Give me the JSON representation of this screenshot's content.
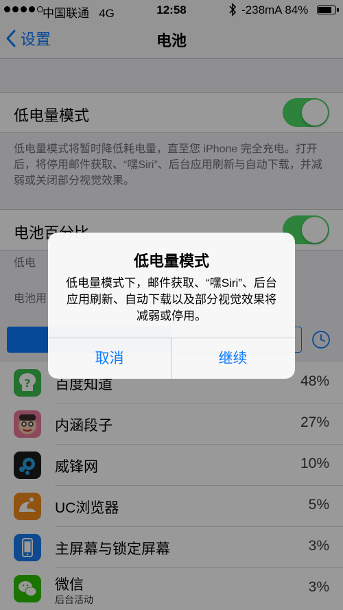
{
  "status_bar": {
    "carrier": "中国联通",
    "network": "4G",
    "time": "12:58",
    "current": "-238mA",
    "battery_percent": "84%",
    "battery_level": 0.84
  },
  "nav": {
    "back_label": "设置",
    "title": "电池"
  },
  "low_power": {
    "label": "低电量模式",
    "enabled": true,
    "description": "低电量模式将暂时降低耗电量，直至您 iPhone 完全充电。打开后，将停用邮件获取、“嘿Siri”、后台应用刷新与自动下载，并减弱或关闭部分视觉效果。"
  },
  "battery_percentage": {
    "label": "电池百分比",
    "enabled": true,
    "footer_1": "低电",
    "footer_2": "电池用"
  },
  "apps": [
    {
      "name": "百度知道",
      "percent": "48%",
      "icon": "baidu-zhidao-icon",
      "color": "#3bbf4b"
    },
    {
      "name": "内涵段子",
      "percent": "27%",
      "icon": "neihan-duanzi-icon",
      "color": "#e05a7a"
    },
    {
      "name": "威锋网",
      "percent": "10%",
      "icon": "weiphone-icon",
      "color": "#1c1c1c"
    },
    {
      "name": "UC浏览器",
      "percent": "5%",
      "icon": "uc-browser-icon",
      "color": "#f08a1c"
    },
    {
      "name": "主屏幕与锁定屏幕",
      "percent": "3%",
      "icon": "home-lock-screen-icon",
      "color": "#1a7cf0"
    },
    {
      "name": "微信",
      "sub": "后台活动",
      "percent": "3%",
      "icon": "wechat-icon",
      "color": "#2dc100"
    }
  ],
  "alert": {
    "title": "低电量模式",
    "message": "低电量模式下，邮件获取、“嘿Siri”、后台应用刷新、自动下载以及部分视觉效果将减弱或停用。",
    "cancel_label": "取消",
    "continue_label": "继续"
  },
  "colors": {
    "accent": "#0a7aff",
    "toggle_on": "#4cd964"
  }
}
